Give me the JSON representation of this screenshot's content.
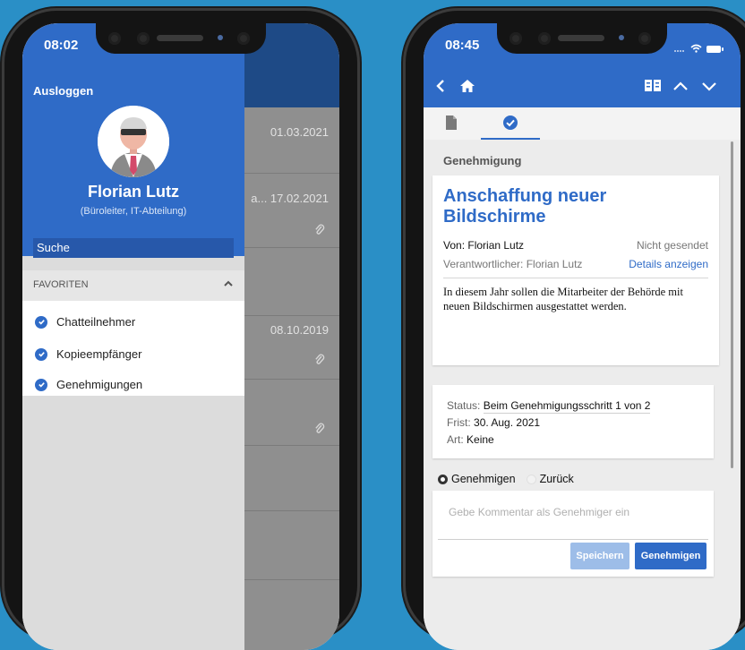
{
  "colors": {
    "background": "#2a8fc6",
    "primary": "#2f6bc7",
    "link": "#2f6bc7"
  },
  "left_phone": {
    "time": "08:02",
    "drawer": {
      "logout_label": "Ausloggen",
      "user_name": "Florian Lutz",
      "user_role": "(Büroleiter, IT-Abteilung)",
      "search_placeholder": "Suche",
      "favorites_title": "FAVORITEN",
      "favorites": [
        {
          "label": "Chatteilnehmer"
        },
        {
          "label": "Kopieempfänger"
        },
        {
          "label": "Genehmigungen"
        }
      ]
    },
    "background_list": [
      {
        "date": "01.03.2021",
        "attachment": false
      },
      {
        "date": "a... 17.02.2021",
        "attachment": true
      },
      {
        "date": "",
        "attachment": false
      },
      {
        "date": "08.10.2019",
        "attachment": true
      },
      {
        "date": "",
        "attachment": true
      }
    ]
  },
  "right_phone": {
    "time": "08:45",
    "section_title": "Genehmigung",
    "document": {
      "title": "Anschaffung neuer Bildschirme",
      "from": "Von: Florian Lutz",
      "send_status": "Nicht gesendet",
      "responsible": "Verantwortlicher: Florian Lutz",
      "details_link": "Details anzeigen",
      "description": "In diesem Jahr sollen die Mitarbeiter der Behörde mit neuen Bildschirmen ausgestattet werden."
    },
    "status": {
      "status_label": "Status:",
      "status_value": "Beim Genehmigungsschritt 1 von 2",
      "deadline_label": "Frist:",
      "deadline_value": "30. Aug. 2021",
      "type_label": "Art:",
      "type_value": "Keine"
    },
    "decision": {
      "approve_label": "Genehmigen",
      "back_label": "Zurück",
      "selected": "Genehmigen"
    },
    "comment_placeholder": "Gebe Kommentar als Genehmiger ein",
    "save_label": "Speichern",
    "approve_button_label": "Genehmigen"
  }
}
